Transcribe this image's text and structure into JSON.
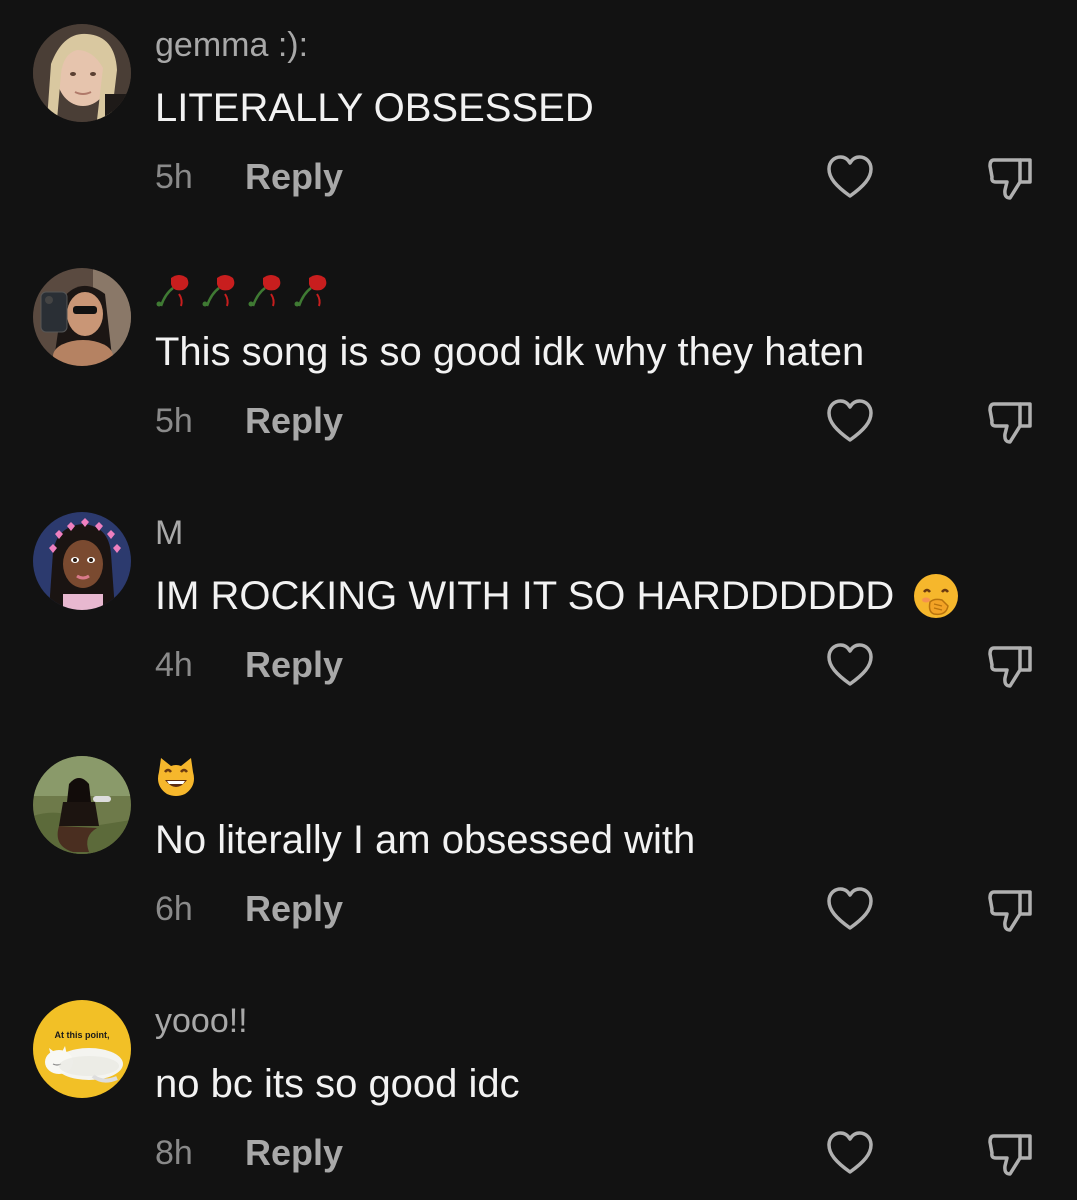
{
  "comments": [
    {
      "username": "gemma :):",
      "text": "LITERALLY OBSESSED",
      "time": "5h",
      "reply_label": "Reply",
      "avatar_icon": "avatar-blonde-selfie"
    },
    {
      "username": "",
      "username_icon": "wilted-roses-emoji",
      "text": "This song is so good idk why they haten",
      "time": "5h",
      "reply_label": "Reply",
      "avatar_icon": "avatar-mirror-selfie"
    },
    {
      "username": "M",
      "text": "IM ROCKING WITH IT SO HARDDDDDD",
      "text_icon": "hand-over-mouth-emoji",
      "time": "4h",
      "reply_label": "Reply",
      "avatar_icon": "avatar-cartoon-hearts"
    },
    {
      "username": "",
      "username_icon": "grinning-cat-emoji",
      "text": "No literally I am obsessed with",
      "time": "6h",
      "reply_label": "Reply",
      "avatar_icon": "avatar-outdoor-grass"
    },
    {
      "username": "yooo!!",
      "text": "no bc its so good idc",
      "time": "8h",
      "reply_label": "Reply",
      "avatar_icon": "avatar-sleeping-cat-meme",
      "avatar_caption": "At this point,"
    }
  ],
  "colors": {
    "background": "#121212",
    "username": "#a8a8a8",
    "text": "#f2f2f2",
    "time": "#8a8a8a",
    "icon": "#b0b0b0"
  }
}
